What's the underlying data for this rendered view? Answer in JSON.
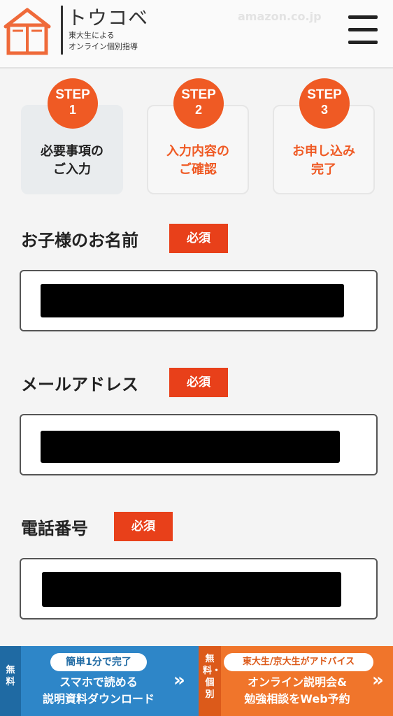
{
  "header": {
    "brand": "トウコベ",
    "tagline_line1": "東大生による",
    "tagline_line2": "オンライン個別指導",
    "ghost_text": "amazon.co.jp",
    "logo_icon": "house-book-icon",
    "menu_icon": "hamburger-icon"
  },
  "steps": [
    {
      "label": "STEP",
      "number": "1",
      "line1": "必要事項の",
      "line2": "ご入力",
      "active": true
    },
    {
      "label": "STEP",
      "number": "2",
      "line1": "入力内容の",
      "line2": "ご確認",
      "active": false
    },
    {
      "label": "STEP",
      "number": "3",
      "line1": "お申し込み",
      "line2": "完了",
      "active": false
    }
  ],
  "form": {
    "required_label": "必須",
    "fields": [
      {
        "label": "お子様のお名前",
        "value": "████████████████████"
      },
      {
        "label": "メールアドレス",
        "value": "████████████████████"
      },
      {
        "label": "電話番号",
        "value": "████████████████████"
      }
    ]
  },
  "banner": {
    "left": {
      "tag": "無料",
      "pill": "簡単1分で完了",
      "line1": "スマホで読める",
      "line2": "説明資料ダウンロード",
      "arrow": "»"
    },
    "right": {
      "tag": "無料・個別",
      "pill": "東大生/京大生がアドバイス",
      "line1": "オンライン説明会&",
      "line2": "勉強相談をWeb予約",
      "arrow": "»"
    }
  },
  "colors": {
    "accent": "#ef5a24",
    "required": "#e8401a",
    "banner_left": "#2e86c8",
    "banner_right": "#f0752b"
  }
}
